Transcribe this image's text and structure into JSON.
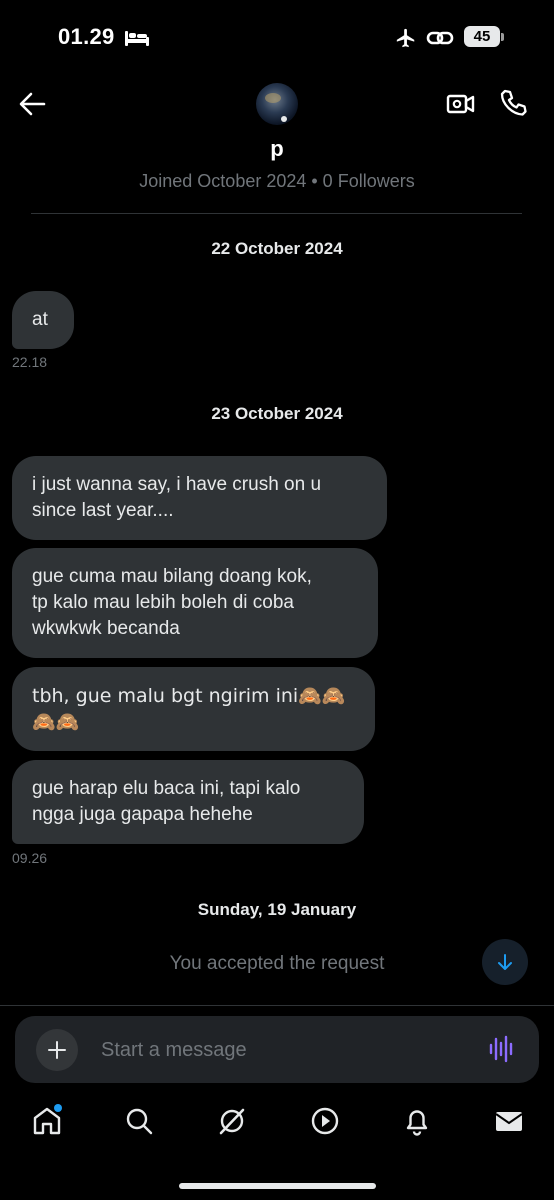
{
  "status_bar": {
    "time": "01.29",
    "battery": "45"
  },
  "header": {
    "display_name": "p",
    "joined": "Joined October 2024 • 0 Followers"
  },
  "messages": {
    "date1": "22 October 2024",
    "m1": "at",
    "time1": "22.18",
    "date2": "23 October 2024",
    "m2_line1": "i just wanna say, i have crush on u",
    "m2_line2": "since last year....",
    "m3_line1": "gue cuma mau bilang doang kok,",
    "m3_line2": "tp kalo mau lebih boleh di coba",
    "m3_line3": "wkwkwk becanda",
    "m4_line1": "tbh, gue malu bgt ngirim ini🙈🙈",
    "m4_line2": "🙈🙈",
    "m5_line1": "gue harap elu baca ini, tapi kalo",
    "m5_line2": "ngga juga gapapa hehehe",
    "time2": "09.26",
    "date3": "Sunday, 19 January",
    "accepted": "You accepted the request"
  },
  "composer": {
    "placeholder": "Start a message"
  },
  "icons": {
    "status": [
      "bed-icon",
      "airplane-icon",
      "link-icon"
    ],
    "header": [
      "back-arrow-icon",
      "video-call-icon",
      "phone-call-icon"
    ],
    "composer": [
      "plus-icon",
      "voice-message-icon"
    ],
    "tabs": [
      "home-icon",
      "search-icon",
      "grok-icon",
      "video-icon",
      "notifications-icon",
      "messages-icon"
    ]
  },
  "colors": {
    "background": "#000000",
    "bubble": "#2f3336",
    "accent": "#1d9bf0",
    "voice": "#8c6cff"
  }
}
